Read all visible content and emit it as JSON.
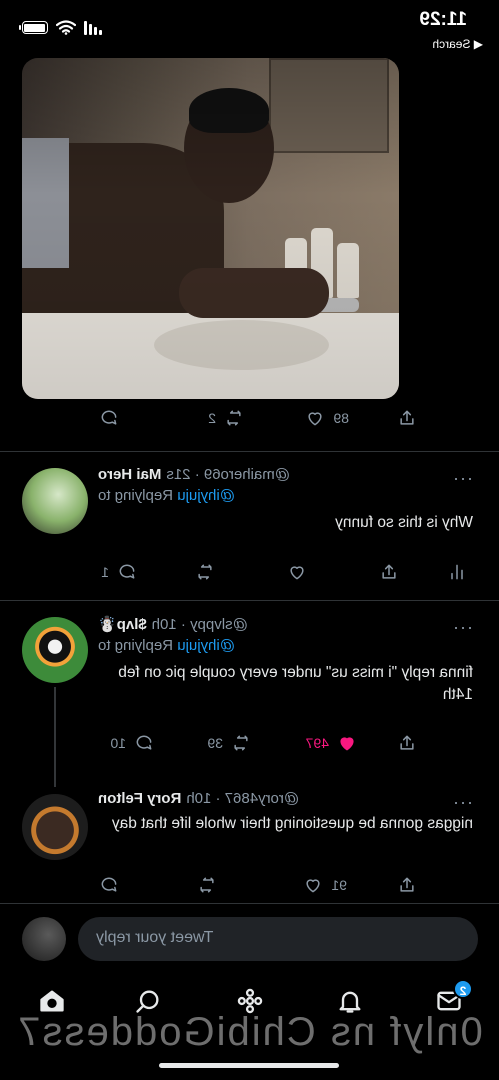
{
  "status_bar": {
    "time": "11:29",
    "back_label": "◀ Search"
  },
  "colors": {
    "accent": "#1d9bf0",
    "like": "#f91880",
    "muted": "#8b98a5",
    "background": "#000000"
  },
  "original_tweet": {
    "media": "photo",
    "actions": {
      "replies": "",
      "retweets": "2",
      "likes": "89",
      "share": ""
    }
  },
  "replies": [
    {
      "name": "Mai Hero",
      "handle": "@maihero69 · 21s",
      "replying_prefix": "Replying to",
      "replying_to": "@ihyjuju",
      "text": "Why is this so funny",
      "more": "···",
      "actions": {
        "replies": "1",
        "retweets": "",
        "likes": "",
        "views": ""
      }
    },
    {
      "name": "$lᴧp☃️",
      "handle": "@slvppy · 10h",
      "replying_prefix": "Replying to",
      "replying_to": "@ihyjuju",
      "text": "finna reply \"i miss us\" under every couple pic on feb 14th",
      "more": "···",
      "actions": {
        "replies": "10",
        "retweets": "39",
        "likes": "497"
      }
    },
    {
      "name": "Rory Felton",
      "handle": "@rory4867 · 10h",
      "text": "niggas gonna be questioning their whole life that day",
      "more": "···",
      "actions": {
        "replies": "",
        "retweets": "",
        "likes": "91"
      }
    }
  ],
  "composer": {
    "placeholder": "Tweet your reply"
  },
  "tabbar": {
    "messages_badge": "2",
    "tabs": [
      "home-icon",
      "search-icon",
      "spaces-icon",
      "notifications-icon",
      "messages-icon"
    ]
  },
  "watermark": "0nlyf ns ChibiGoddess7"
}
